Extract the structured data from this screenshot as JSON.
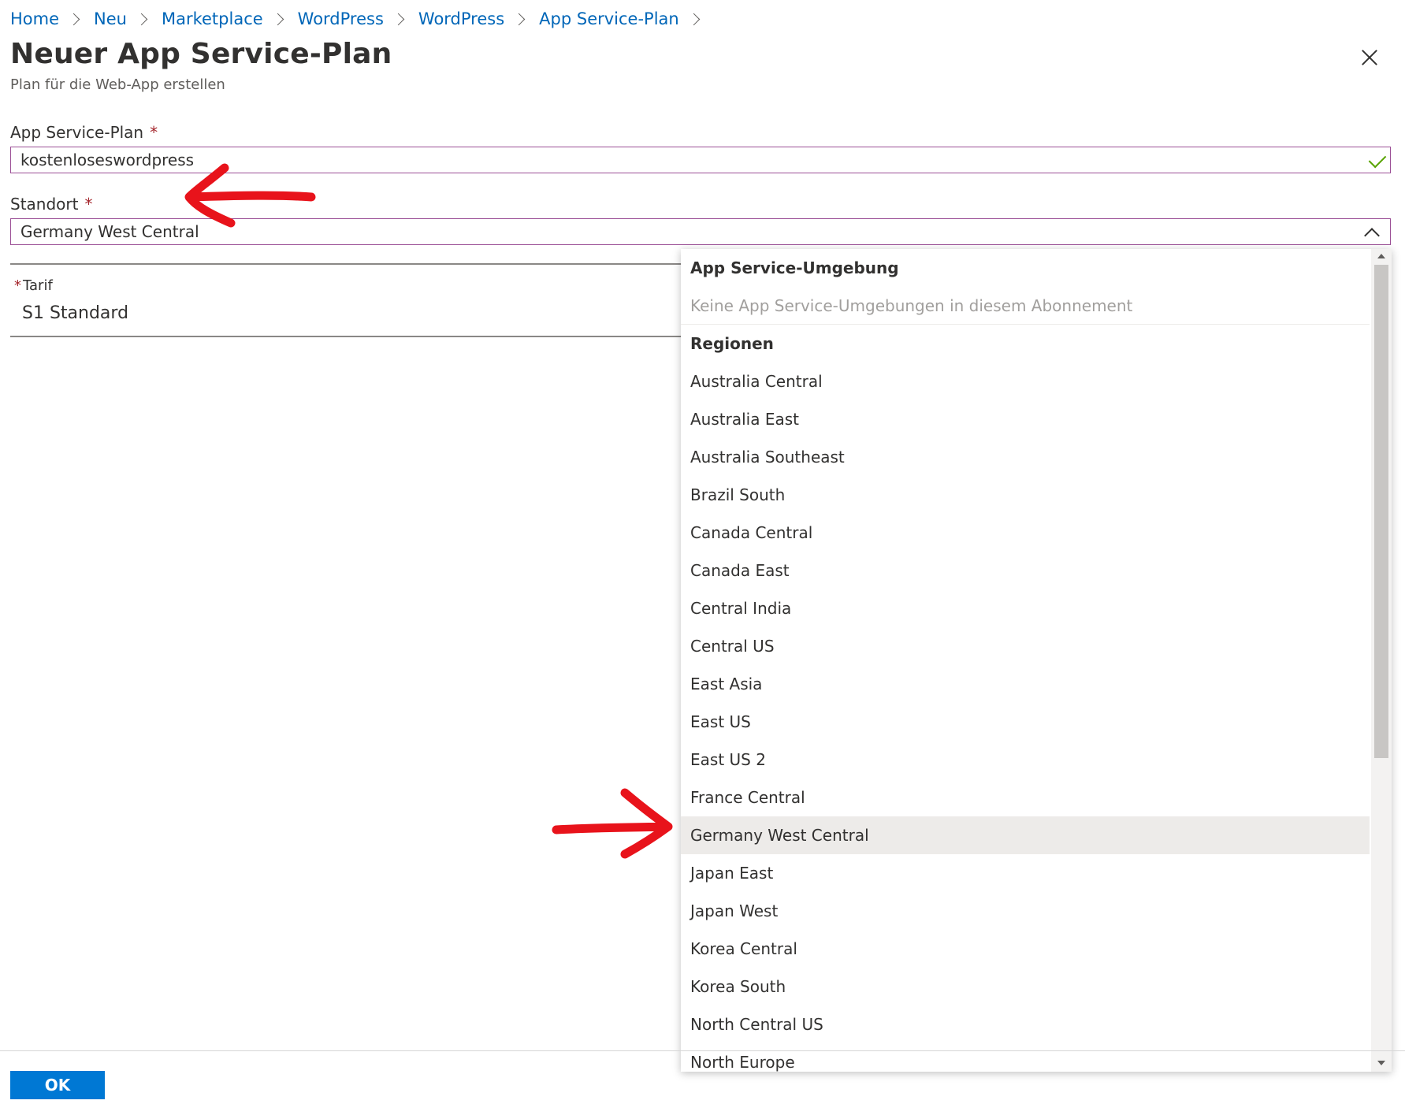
{
  "breadcrumb": [
    {
      "label": "Home"
    },
    {
      "label": "Neu"
    },
    {
      "label": "Marketplace"
    },
    {
      "label": "WordPress"
    },
    {
      "label": "WordPress"
    },
    {
      "label": "App Service-Plan"
    }
  ],
  "page": {
    "title": "Neuer App Service-Plan",
    "subtitle": "Plan für die Web-App erstellen"
  },
  "form": {
    "plan": {
      "label": "App Service-Plan",
      "required_mark": "*",
      "value": "kostenloseswordpress"
    },
    "location": {
      "label": "Standort",
      "required_mark": "*",
      "value": "Germany West Central"
    },
    "tier": {
      "required_mark": "*",
      "label": "Tarif",
      "value": "S1 Standard"
    }
  },
  "dropdown": {
    "group1_header": "App Service-Umgebung",
    "group1_empty": "Keine App Service-Umgebungen in diesem Abonnement",
    "group2_header": "Regionen",
    "regions": [
      "Australia Central",
      "Australia East",
      "Australia Southeast",
      "Brazil South",
      "Canada Central",
      "Canada East",
      "Central India",
      "Central US",
      "East Asia",
      "East US",
      "East US 2",
      "France Central",
      "Germany West Central",
      "Japan East",
      "Japan West",
      "Korea Central",
      "Korea South",
      "North Central US",
      "North Europe"
    ],
    "selected": "Germany West Central"
  },
  "footer": {
    "ok_label": "OK"
  },
  "colors": {
    "link": "#0066b8",
    "primary_button": "#0078d4",
    "focus_border": "#9b4f96",
    "valid_check": "#57a300",
    "annotation_arrow": "#e8131b",
    "selected_row": "#edebe9"
  },
  "icons": [
    "chevron-right-icon",
    "close-icon",
    "checkmark-icon",
    "chevron-up-icon",
    "scroll-up-icon",
    "scroll-down-icon"
  ]
}
